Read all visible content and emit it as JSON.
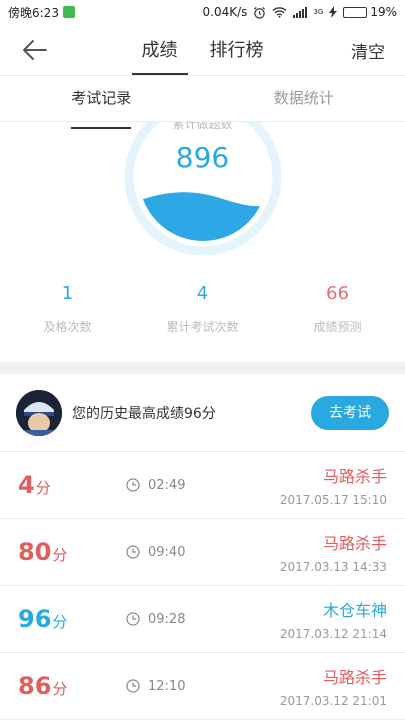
{
  "status": {
    "time": "傍晚6:23",
    "speed": "0.04K/s",
    "net": "3G",
    "battery_text": "19%",
    "battery_level": 0.19
  },
  "nav": {
    "tabs": [
      "成绩",
      "排行榜"
    ],
    "active_tab": 0,
    "clear": "清空"
  },
  "sub_tabs": [
    "考试记录",
    "数据统计"
  ],
  "gauge": {
    "label": "累计做题数",
    "value": "896"
  },
  "stats": [
    {
      "value": "1",
      "label": "及格次数"
    },
    {
      "value": "4",
      "label": "累计考试次数"
    },
    {
      "value": "66",
      "label": "成绩预测"
    }
  ],
  "best": {
    "text": "您的历史最高成绩96分",
    "button": "去考试"
  },
  "records": [
    {
      "score": "4",
      "unit": "分",
      "duration": "02:49",
      "title": "马路杀手",
      "date": "2017.05.17  15:10",
      "color": "#e25d5d"
    },
    {
      "score": "80",
      "unit": "分",
      "duration": "09:40",
      "title": "马路杀手",
      "date": "2017.03.13  14:33",
      "color": "#e25d5d"
    },
    {
      "score": "96",
      "unit": "分",
      "duration": "09:28",
      "title": "木仓车神",
      "date": "2017.03.12  21:14",
      "color": "#29a9e0"
    },
    {
      "score": "86",
      "unit": "分",
      "duration": "12:10",
      "title": "马路杀手",
      "date": "2017.03.12  21:01",
      "color": "#e25d5d"
    }
  ]
}
